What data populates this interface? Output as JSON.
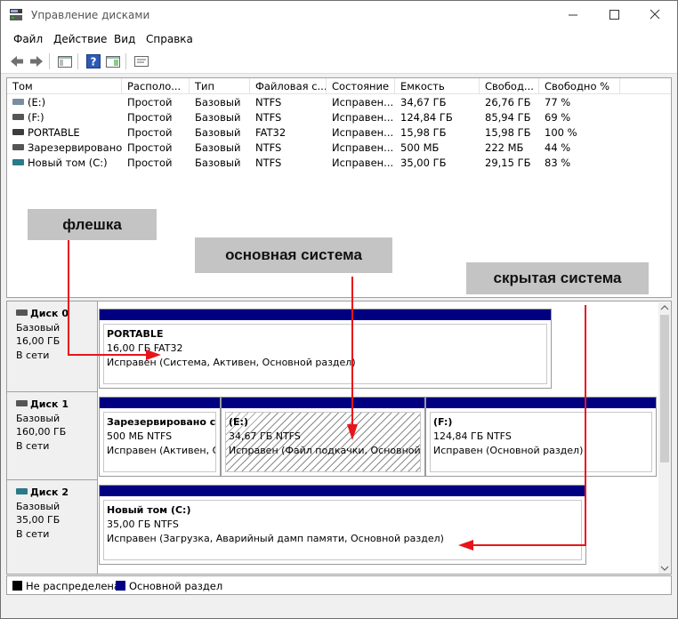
{
  "window": {
    "title": "Управление дисками"
  },
  "menu": [
    "Файл",
    "Действие",
    "Вид",
    "Справка"
  ],
  "columns": [
    "Том",
    "Располо...",
    "Тип",
    "Файловая с...",
    "Состояние",
    "Емкость",
    "Свобод...",
    "Свободно %"
  ],
  "volumes": [
    {
      "name": "(E:)",
      "layout": "Простой",
      "type": "Базовый",
      "fs": "NTFS",
      "status": "Исправен...",
      "capacity": "34,67 ГБ",
      "free": "26,76 ГБ",
      "free_pct": "77 %",
      "icon": "volume-icon"
    },
    {
      "name": "(F:)",
      "layout": "Простой",
      "type": "Базовый",
      "fs": "NTFS",
      "status": "Исправен...",
      "capacity": "124,84 ГБ",
      "free": "85,94 ГБ",
      "free_pct": "69 %",
      "icon": "volume-icon"
    },
    {
      "name": "PORTABLE",
      "layout": "Простой",
      "type": "Базовый",
      "fs": "FAT32",
      "status": "Исправен...",
      "capacity": "15,98 ГБ",
      "free": "15,98 ГБ",
      "free_pct": "100 %",
      "icon": "usb-volume-icon"
    },
    {
      "name": "Зарезервировано...",
      "layout": "Простой",
      "type": "Базовый",
      "fs": "NTFS",
      "status": "Исправен...",
      "capacity": "500 МБ",
      "free": "222 МБ",
      "free_pct": "44 %",
      "icon": "volume-icon"
    },
    {
      "name": "Новый том (C:)",
      "layout": "Простой",
      "type": "Базовый",
      "fs": "NTFS",
      "status": "Исправен...",
      "capacity": "35,00 ГБ",
      "free": "29,15 ГБ",
      "free_pct": "83 %",
      "icon": "system-volume-icon"
    }
  ],
  "annotations": {
    "flash": "флешка",
    "main_system": "основная система",
    "hidden_system": "скрытая система"
  },
  "disks": [
    {
      "name": "Диск 0",
      "type": "Базовый",
      "size": "16,00 ГБ",
      "state": "В сети",
      "partitions": [
        {
          "name": "PORTABLE",
          "info": "16,00 ГБ FAT32",
          "status": "Исправен (Система, Активен, Основной раздел)"
        }
      ]
    },
    {
      "name": "Диск 1",
      "type": "Базовый",
      "size": "160,00 ГБ",
      "state": "В сети",
      "partitions": [
        {
          "name": "Зарезервировано си",
          "info": "500 МБ NTFS",
          "status": "Исправен (Активен, О"
        },
        {
          "name": "(E:)",
          "info": "34,67 ГБ NTFS",
          "status": "Исправен (Файл подкачки, Основной р"
        },
        {
          "name": "(F:)",
          "info": "124,84 ГБ NTFS",
          "status": "Исправен (Основной раздел)"
        }
      ]
    },
    {
      "name": "Диск 2",
      "type": "Базовый",
      "size": "35,00 ГБ",
      "state": "В сети",
      "partitions": [
        {
          "name": "Новый том  (C:)",
          "info": "35,00 ГБ NTFS",
          "status": "Исправен (Загрузка, Аварийный дамп памяти, Основной раздел)"
        }
      ]
    }
  ],
  "legend": [
    {
      "label": "Не распределена",
      "color": "#000000"
    },
    {
      "label": "Основной раздел",
      "color": "#000080"
    }
  ],
  "colors": {
    "partition_bar": "#000080",
    "arrow": "#e8141b",
    "annotation_bg": "#c4c4c4"
  }
}
